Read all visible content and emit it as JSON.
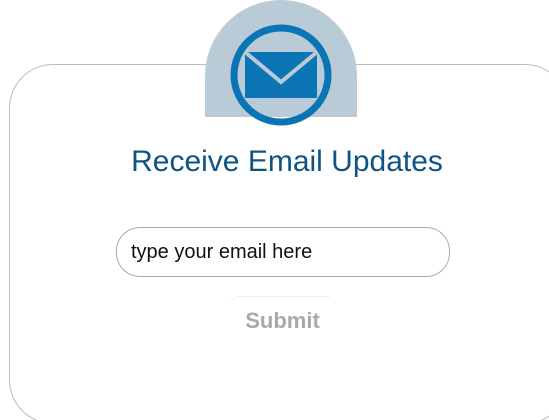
{
  "widget": {
    "title": "Receive Email Updates",
    "icon": "envelope-icon",
    "email_placeholder": "type your email here",
    "email_value": "",
    "submit_label": "Submit"
  },
  "colors": {
    "title": "#0d5384",
    "icon_badge": "#b9cbd6",
    "icon": "#0a74b5",
    "submit_text": "#a7a9ab",
    "card_border": "#b8bcbf"
  }
}
